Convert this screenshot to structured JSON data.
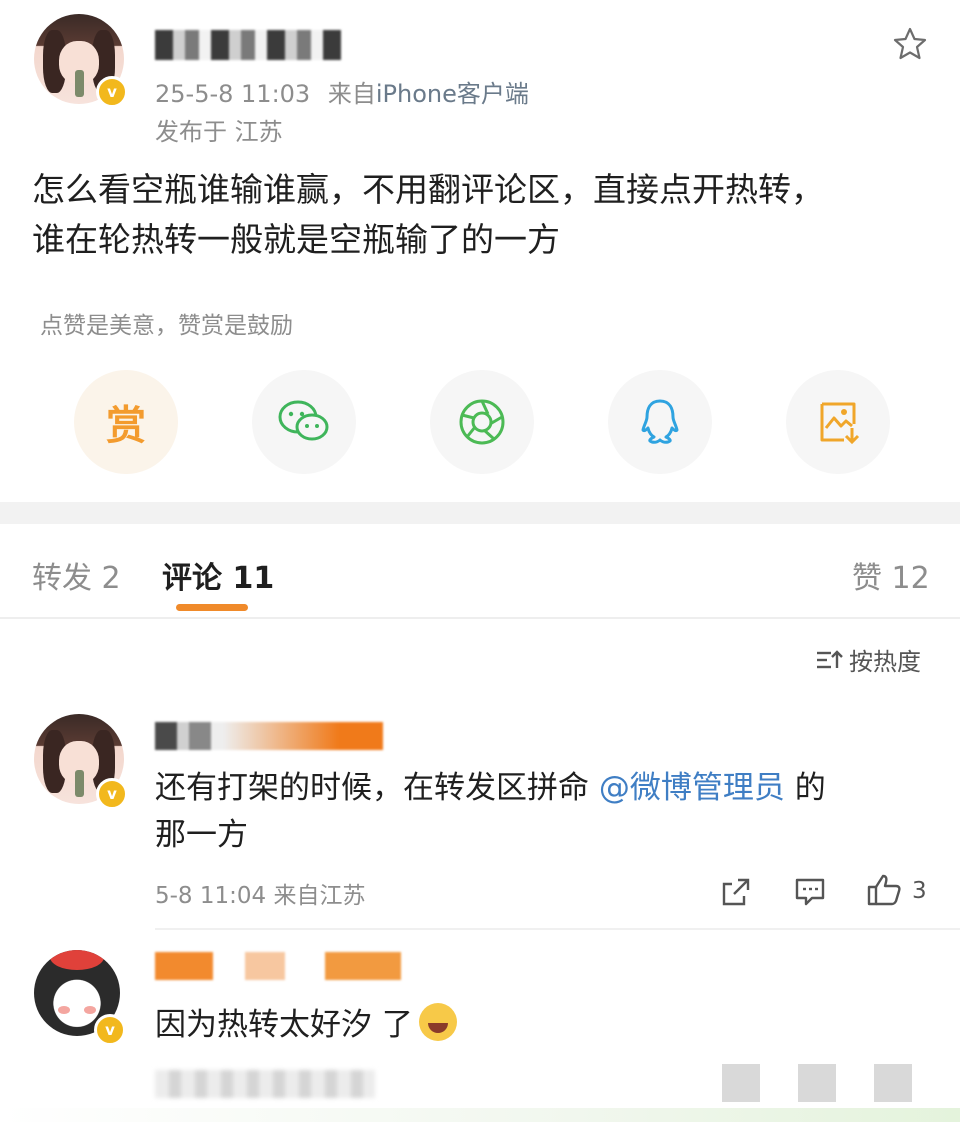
{
  "post": {
    "timestamp": "25-5-8 11:03",
    "source_prefix": "来自",
    "source": "iPhone客户端",
    "location": "发布于 江苏",
    "text_line1": "怎么看空瓶谁输谁赢，不用翻评论区，直接点开热转，",
    "text_line2": "谁在轮热转一般就是空瓶输了的一方",
    "reward_hint": "点赞是美意，赞赏是鼓励",
    "reward_label": "赏"
  },
  "tabs": {
    "repost": "转发 2",
    "comments": "评论 11",
    "likes": "赞 12"
  },
  "sort_label": "按热度",
  "comments": [
    {
      "text_before": "还有打架的时候，在转发区拼命 ",
      "mention": "@微博管理员",
      "text_after": " 的",
      "text_line2": "那一方",
      "meta": "5-8 11:04 来自江苏",
      "like_count": "3"
    },
    {
      "text": "因为热转太好汐 了"
    }
  ],
  "colors": {
    "accent": "#f08a2a",
    "mention": "#3f7ec4",
    "vip_badge": "#f2b81d"
  },
  "icons": [
    "star-icon",
    "wechat-icon",
    "moments-icon",
    "qq-icon",
    "save-image-icon",
    "sort-icon",
    "repost-icon",
    "comment-icon",
    "like-icon",
    "laugh-emoji"
  ]
}
